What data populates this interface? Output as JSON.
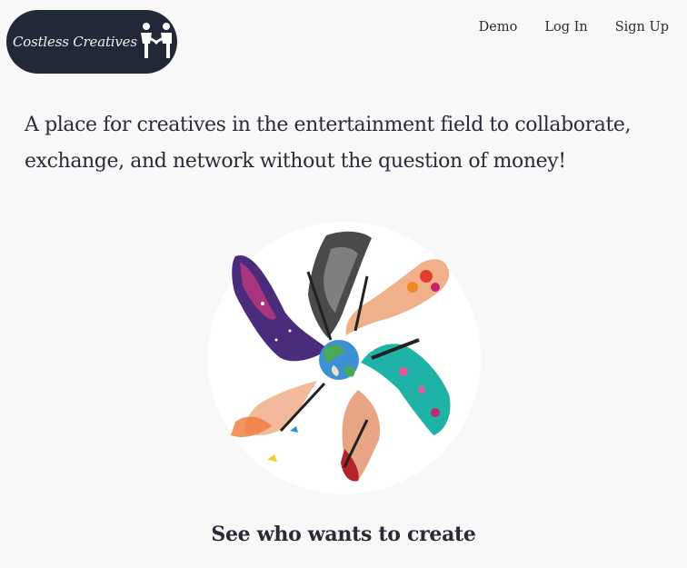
{
  "brand": {
    "name": "Costless Creatives",
    "logo_icon": "two-people-hands-icon"
  },
  "nav": {
    "demo": "Demo",
    "login": "Log In",
    "signup": "Sign Up"
  },
  "hero": {
    "headline": "A place for creatives in the entertainment field to collaborate, exchange, and network without the question of money!",
    "image_icon": "artistic-hands-globe-illustration",
    "subheading": "See who wants to create"
  },
  "colors": {
    "background": "#f8f8f8",
    "logo_bg": "#232839",
    "text": "#2b2b38"
  }
}
